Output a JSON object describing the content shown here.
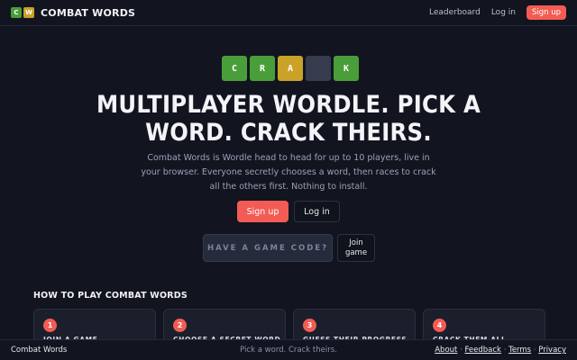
{
  "nav": {
    "logo_tiles": [
      {
        "letter": "C",
        "color": "#4a9e3a"
      },
      {
        "letter": "W",
        "color": "#c9a227"
      }
    ],
    "brand": "COMBAT WORDS",
    "leaderboard": "Leaderboard",
    "login": "Log in",
    "signup": "Sign up"
  },
  "hero": {
    "tiles": [
      {
        "letter": "C",
        "state": "green"
      },
      {
        "letter": "R",
        "state": "green"
      },
      {
        "letter": "A",
        "state": "yellow"
      },
      {
        "letter": "",
        "state": "empty"
      },
      {
        "letter": "K",
        "state": "green"
      }
    ],
    "headline": "MULTIPLAYER WORDLE. PICK A WORD. CRACK THEIRS.",
    "subtext": "Combat Words is Wordle head to head for up to 10 players, live in your browser. Everyone secretly chooses a word, then races to crack all the others first. Nothing to install.",
    "signup_button": "Sign up",
    "login_button": "Log in",
    "code_placeholder": "HAVE A GAME CODE?",
    "join_button": "Join game"
  },
  "how_to_play": {
    "title": "HOW TO PLAY COMBAT WORDS",
    "steps": [
      {
        "number": "1",
        "title": "JOIN A GAME"
      },
      {
        "number": "2",
        "title": "CHOOSE A SECRET WORD"
      },
      {
        "number": "3",
        "title": "GUESS THEIR PROGRESS"
      },
      {
        "number": "4",
        "title": "CRACK THEM ALL"
      }
    ]
  },
  "footer": {
    "brand": "Combat Words",
    "tagline": "Pick a word. Crack theirs.",
    "links": [
      "About",
      "Feedback",
      "Terms",
      "Privacy"
    ],
    "separator": " · "
  },
  "colors": {
    "background": "#121520",
    "accent": "#f25c54",
    "tile_green": "#4a9e3a",
    "tile_yellow": "#c9a227",
    "tile_empty": "#363b4e"
  }
}
